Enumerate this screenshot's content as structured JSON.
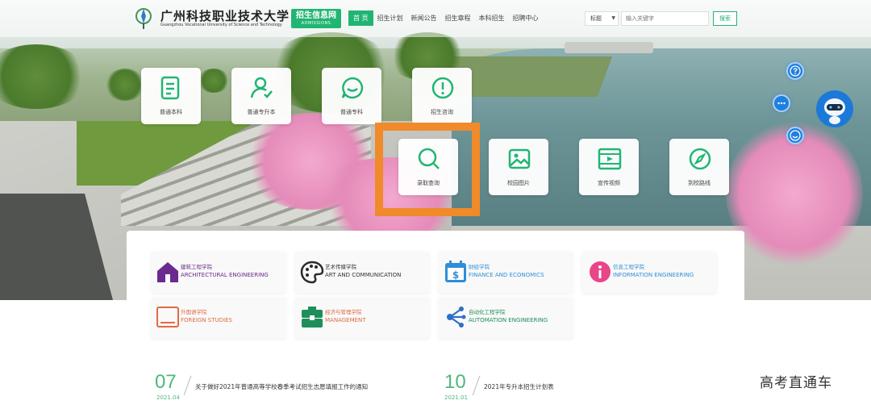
{
  "header": {
    "logo_cn": "广州科技职业技术大学",
    "logo_en": "Guangzhou Vocational University of Science and Technology",
    "badge_cn": "招生信息网",
    "badge_en": "ADMISSIONS",
    "nav": [
      "首 页",
      "招生计划",
      "新闻公告",
      "招生章程",
      "本科招生",
      "招聘中心"
    ],
    "search": {
      "type": "标题",
      "placeholder": "输入关键字",
      "button": "搜索"
    }
  },
  "tiles": [
    {
      "label": "普通本科",
      "icon": "document-icon"
    },
    {
      "label": "普通专升本",
      "icon": "user-check-icon"
    },
    {
      "label": "普通专科",
      "icon": "chat-icon"
    },
    {
      "label": "招生咨询",
      "icon": "alert-icon"
    },
    {
      "label": "录取查询",
      "icon": "search-icon"
    },
    {
      "label": "校园图片",
      "icon": "image-icon"
    },
    {
      "label": "宣传视频",
      "icon": "video-icon"
    },
    {
      "label": "到校路线",
      "icon": "compass-icon"
    }
  ],
  "colleges": [
    {
      "cn": "建筑工程学院",
      "en": "ARCHITECTURAL ENGINEERING",
      "color": "#6a2a8f",
      "icon": "house-icon"
    },
    {
      "cn": "艺术传媒学院",
      "en": "ART AND COMMUNICATION",
      "color": "#2b2b2b",
      "icon": "palette-icon"
    },
    {
      "cn": "财经学院",
      "en": "FINANCE AND ECONOMICS",
      "color": "#2f8fd6",
      "icon": "calendar-dollar-icon"
    },
    {
      "cn": "信息工程学院",
      "en": "INFORMATION ENGINEERING",
      "color": "#e8458b",
      "icon": "info-icon"
    },
    {
      "cn": "外国语学院",
      "en": "FOREIGN STUDIES",
      "color": "#e36a43",
      "icon": "book-icon"
    },
    {
      "cn": "经济与管理学院",
      "en": "MANAGEMENT",
      "color": "#1e8f5a",
      "icon": "toolbox-icon"
    },
    {
      "cn": "自动化工程学院",
      "en": "AUTOMATION ENGINEERING",
      "color": "#2e6ec6",
      "icon": "network-icon"
    }
  ],
  "news": [
    {
      "day": "07",
      "date": "2021.04",
      "title": "关于做好2021年普通高等学校春季考试招生志愿填报工作的通知"
    },
    {
      "day": "10",
      "date": "2021.01",
      "title": "2021年专升本招生计划表"
    }
  ],
  "watermark": "高考直通车",
  "colors": {
    "accent": "#21b573",
    "highlight": "#f08a2a",
    "widget": "#1f7fe0"
  }
}
